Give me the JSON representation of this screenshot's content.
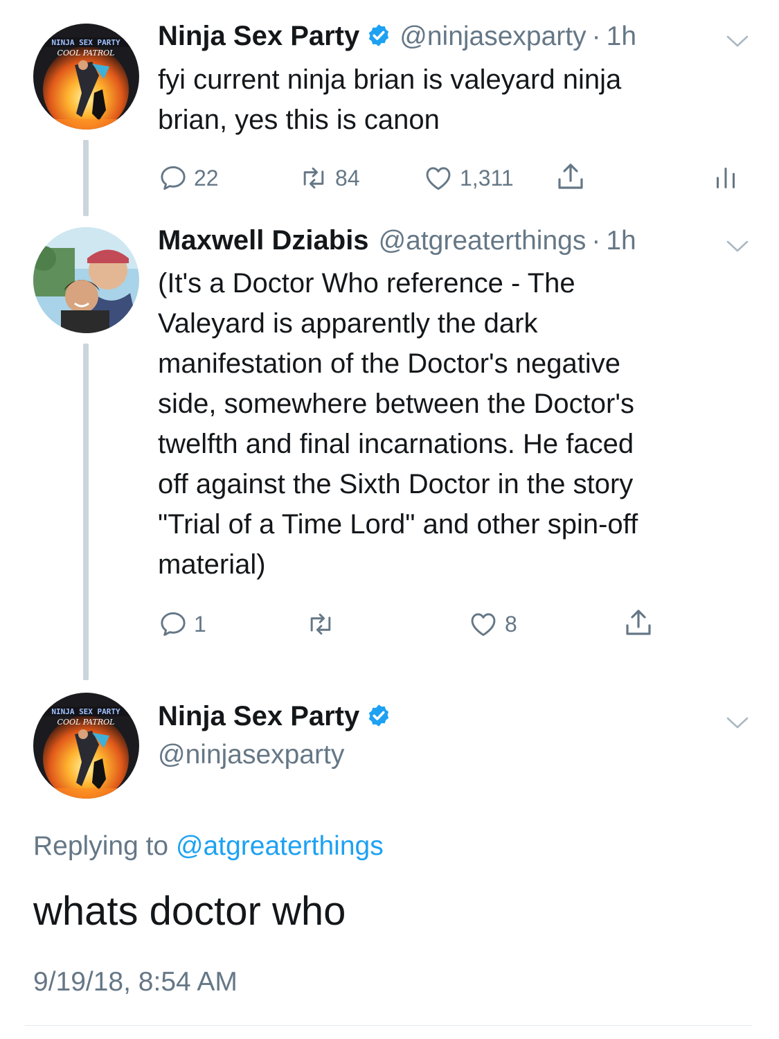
{
  "tweets": [
    {
      "name": "Ninja Sex Party",
      "handle": "@ninjasexparty",
      "time_sep": "·",
      "time": "1h",
      "lines": [
        "fyi current ninja brian is valeyard ninja",
        "brian, yes this is canon"
      ],
      "replies": "22",
      "retweets": "84",
      "likes": "1,311"
    },
    {
      "name": "Maxwell Dziabis",
      "handle": "@atgreaterthings",
      "time_sep": "·",
      "time": "1h",
      "lines": [
        "(It's a Doctor Who reference - The",
        "Valeyard is apparently the dark",
        "manifestation of the Doctor's negative",
        "side, somewhere between the Doctor's",
        "twelfth and final incarnations. He faced",
        "off against the Sixth Doctor in the story",
        "\"Trial of a Time Lord\" and other spin-off",
        "material)"
      ],
      "replies": "1",
      "retweets": "",
      "likes": "8"
    }
  ],
  "focused": {
    "name": "Ninja Sex Party",
    "handle": "@ninjasexparty",
    "replying_prefix": "Replying to",
    "replying_handle": "@atgreaterthings",
    "text": "whats doctor who",
    "timestamp": "9/19/18, 8:54 AM"
  },
  "avatar_text": {
    "banner": "NINJA SEX PARTY",
    "subtitle": "COOL PATROL"
  },
  "colors": {
    "accent": "#1da1f2",
    "secondary_text": "#657786",
    "primary_text": "#14171a",
    "thread_line": "#cdd5dc"
  },
  "icons": [
    "reply-icon",
    "retweet-icon",
    "like-icon",
    "share-icon",
    "analytics-icon",
    "verified-badge-icon",
    "chevron-down-icon"
  ]
}
